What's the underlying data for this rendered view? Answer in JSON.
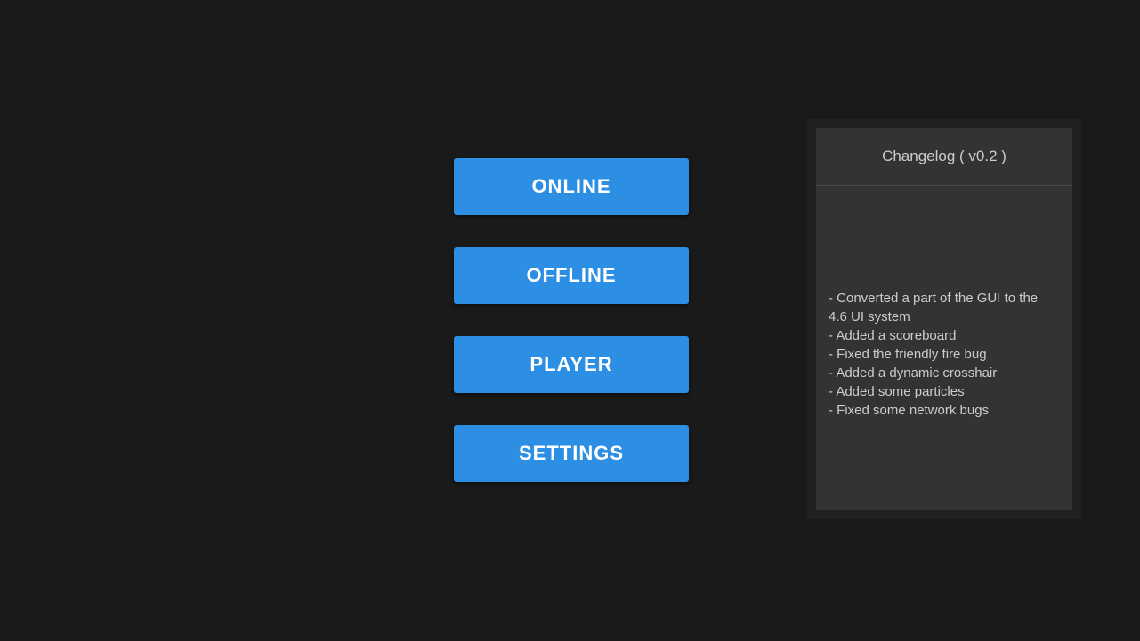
{
  "menu": {
    "online": "ONLINE",
    "offline": "OFFLINE",
    "player": "PLAYER",
    "settings": "SETTINGS"
  },
  "changelog": {
    "title": "Changelog ( v0.2 )",
    "items": [
      "- Converted a part of the GUI to the 4.6 UI system",
      "- Added a scoreboard",
      "- Fixed the friendly fire bug",
      "- Added a dynamic crosshair",
      "- Added some particles",
      "- Fixed some network bugs"
    ]
  }
}
